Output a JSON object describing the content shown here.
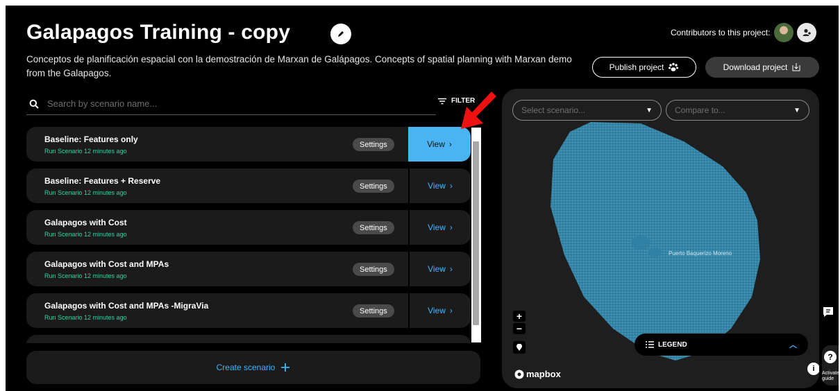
{
  "project": {
    "title": "Galapagos Training  - copy",
    "description": "Conceptos de planificación espacial con la demostración de Marxan de Galápagos. Concepts of spatial planning with Marxan demo from the Galapagos.",
    "contributors_label": "Contributors to this project:",
    "publish_label": "Publish project",
    "download_label": "Download project"
  },
  "search": {
    "placeholder": "Search by scenario name..."
  },
  "filter": {
    "label": "FILTER"
  },
  "scenarios": [
    {
      "name": "Baseline: Features only",
      "meta": "Run Scenario 12 minutes ago",
      "settings": "Settings",
      "view": "View"
    },
    {
      "name": "Baseline: Features + Reserve",
      "meta": "Run Scenario 12 minutes ago",
      "settings": "Settings",
      "view": "View"
    },
    {
      "name": "Galapagos with Cost",
      "meta": "Run Scenario 12 minutes ago",
      "settings": "Settings",
      "view": "View"
    },
    {
      "name": "Galapagos with Cost and MPAs",
      "meta": "Run Scenario 12 minutes ago",
      "settings": "Settings",
      "view": "View"
    },
    {
      "name": "Galapagos with Cost and MPAs -MigraVia",
      "meta": "Run Scenario 12 minutes ago",
      "settings": "Settings",
      "view": "View"
    }
  ],
  "create": {
    "label": "Create scenario"
  },
  "map": {
    "select_placeholder": "Select scenario...",
    "compare_placeholder": "Compare to...",
    "place_label": "Puerto Baquerizo Moreno",
    "legend_label": "LEGEND",
    "attribution": "mapbox",
    "grid_color": "#3b8fb3"
  },
  "guide": {
    "label": "Activate guide"
  },
  "colors": {
    "accent": "#3fb6ff",
    "active_view": "#4ab4f2",
    "run_meta": "#2ed3a3",
    "annotation_arrow": "#e11"
  }
}
